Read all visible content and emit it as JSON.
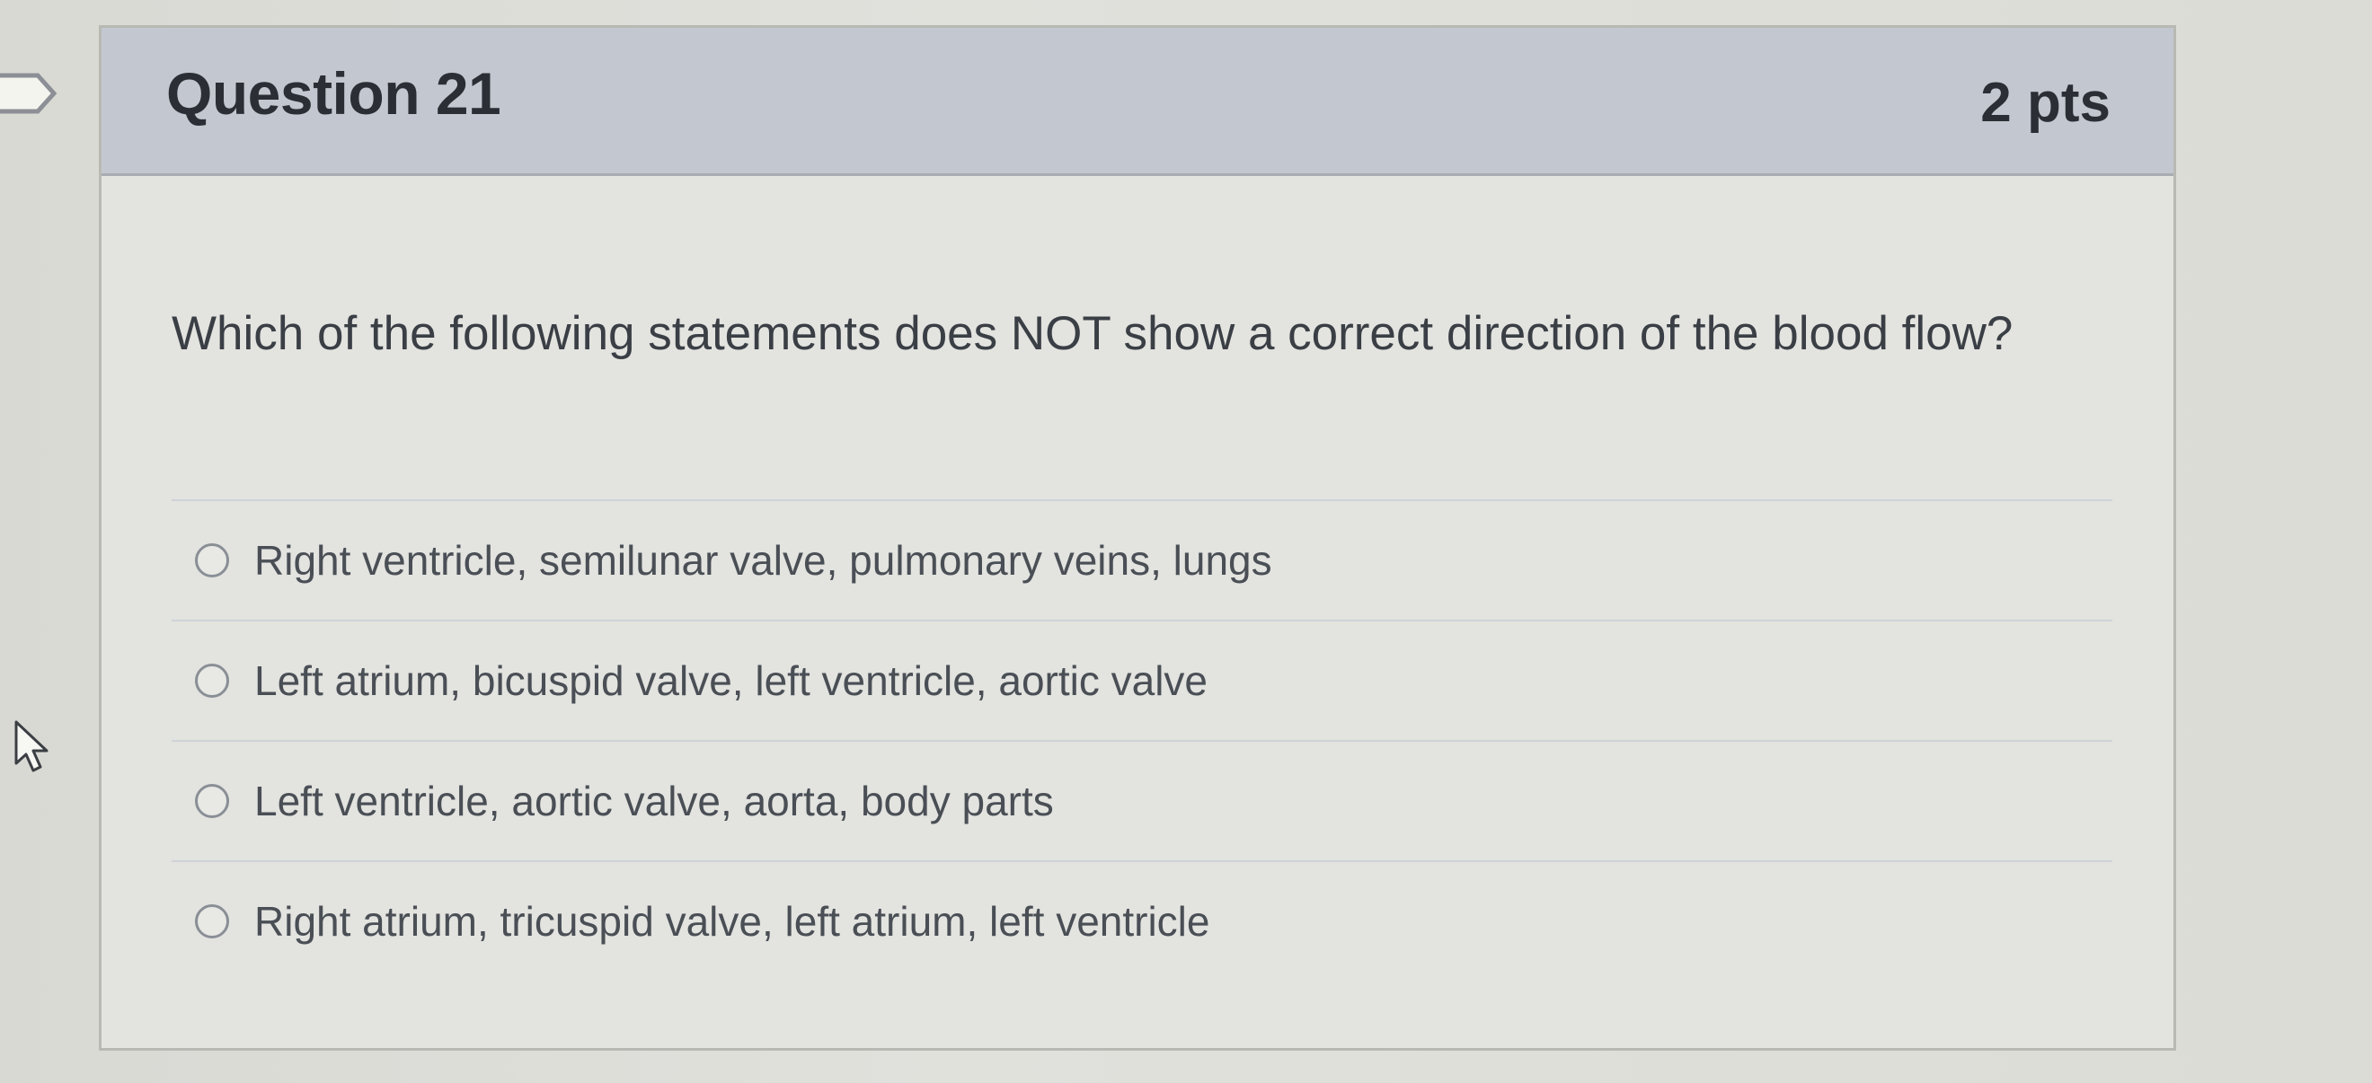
{
  "question": {
    "title": "Question 21",
    "points": "2 pts",
    "text": "Which of the following statements does NOT show a correct direction of the blood flow?",
    "answers": [
      "Right ventricle, semilunar valve, pulmonary veins, lungs",
      "Left atrium, bicuspid valve, left ventricle, aortic valve",
      "Left ventricle, aortic valve, aorta, body parts",
      "Right atrium, tricuspid valve, left atrium, left ventricle"
    ]
  },
  "icons": {
    "bookmark": "bookmark-flag-icon",
    "cursor": "mouse-pointer-icon"
  }
}
